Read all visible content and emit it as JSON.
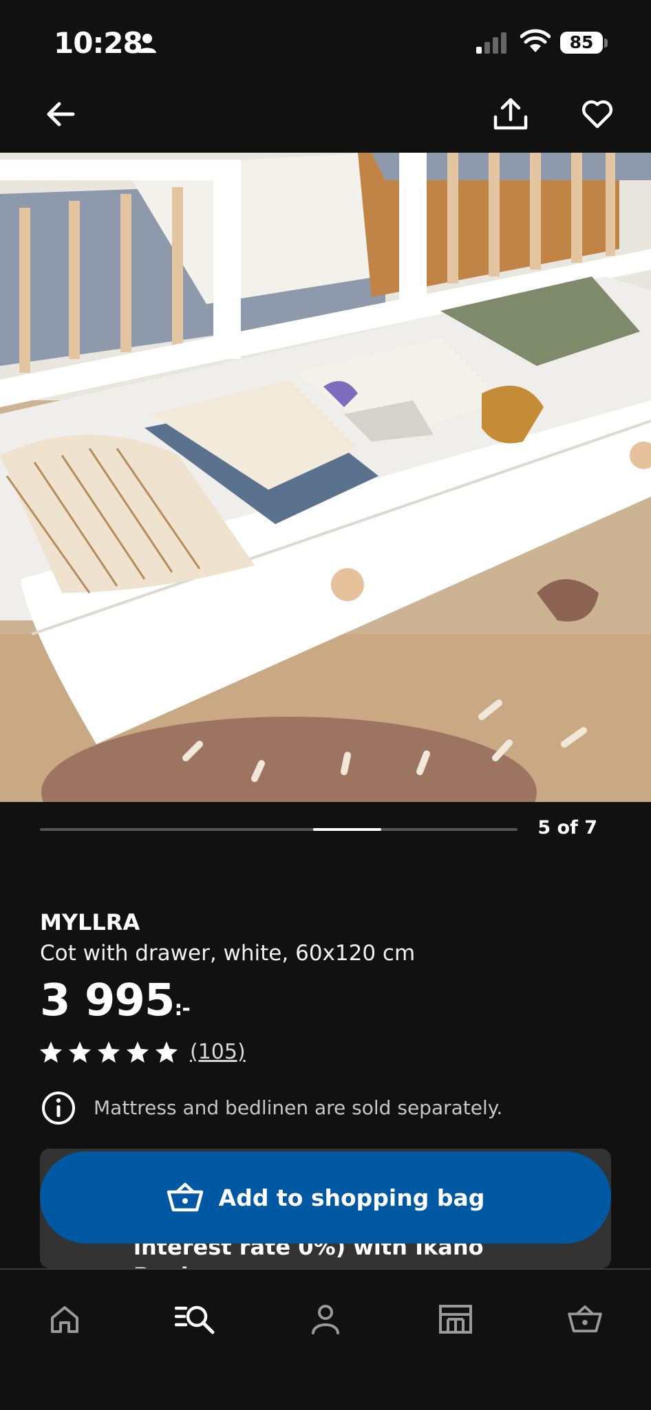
{
  "status_bar": {
    "time": "10:28",
    "battery": "85",
    "icons": [
      "person-icon",
      "signal-icon",
      "wifi-icon",
      "battery-icon"
    ]
  },
  "top_nav": {
    "icons": [
      "back-arrow-icon",
      "share-icon",
      "heart-icon"
    ]
  },
  "carousel": {
    "page_label": "5 of 7",
    "current": 5,
    "total": 7
  },
  "product": {
    "name": "MYLLRA",
    "description": "Cot with drawer, white, 60x120 cm",
    "price": "3 995",
    "price_suffix": ":-",
    "rating": 5,
    "review_count": "(105)",
    "notice": "Mattress and bedlinen are sold separately."
  },
  "finance_card": {
    "text_line1": "interest rate 0%) with Ikano",
    "text_line2": "Bank"
  },
  "cta": {
    "label": "Add to shopping bag",
    "icon": "basket-icon"
  },
  "tab_bar": {
    "items": [
      "home-icon",
      "search-list-icon",
      "profile-icon",
      "store-icon",
      "basket-icon"
    ],
    "active": "search-list-icon"
  },
  "colors": {
    "background": "#111111",
    "accent": "#0058a3",
    "card": "#333333"
  }
}
